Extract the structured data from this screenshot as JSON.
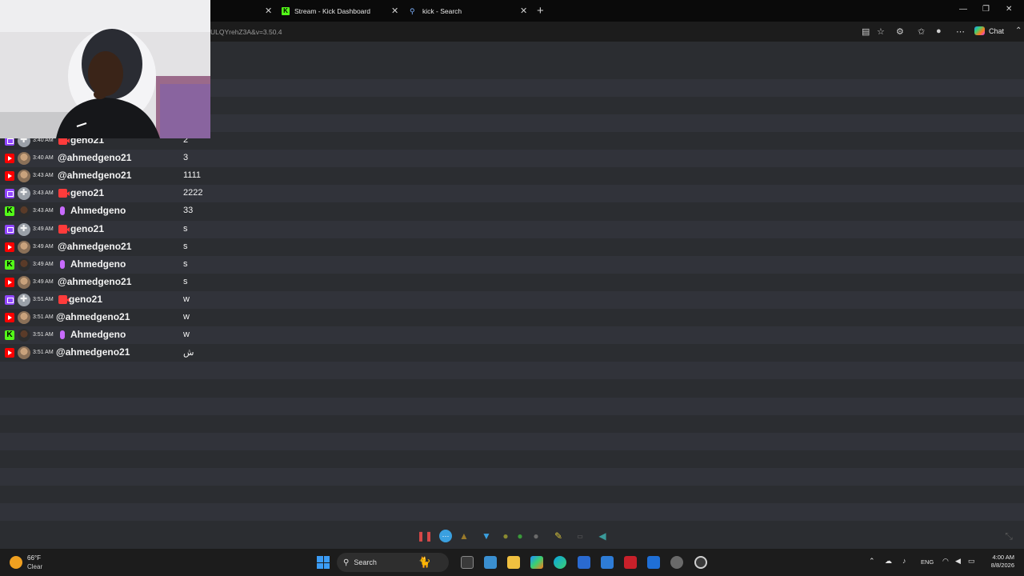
{
  "browser": {
    "tabs": [
      {
        "label": ""
      },
      {
        "label": "Stream - Kick Dashboard",
        "icon": "kick-icon"
      },
      {
        "label": "kick - Search",
        "icon": "search-icon"
      }
    ],
    "url": "ULQYrehZ3A&v=3.50.4",
    "chat_label": "Chat"
  },
  "chat": {
    "messages": [
      {
        "platform": "twitch",
        "time": "3:40 AM",
        "badge": "cam",
        "user": "geno21",
        "text": "2"
      },
      {
        "platform": "youtube",
        "time": "3:40 AM",
        "badge": "",
        "user": "@ahmedgeno21",
        "text": "3"
      },
      {
        "platform": "youtube",
        "time": "3:43 AM",
        "badge": "",
        "user": "@ahmedgeno21",
        "text": "1111"
      },
      {
        "platform": "twitch",
        "time": "3:43 AM",
        "badge": "cam",
        "user": "geno21",
        "text": "2222"
      },
      {
        "platform": "kick",
        "time": "3:43 AM",
        "badge": "mic",
        "user": "Ahmedgeno",
        "text": "33"
      },
      {
        "platform": "twitch",
        "time": "3:49 AM",
        "badge": "cam",
        "user": "geno21",
        "text": "s"
      },
      {
        "platform": "youtube",
        "time": "3:49 AM",
        "badge": "",
        "user": "@ahmedgeno21",
        "text": "s"
      },
      {
        "platform": "kick",
        "time": "3:49 AM",
        "badge": "mic",
        "user": "Ahmedgeno",
        "text": "s"
      },
      {
        "platform": "youtube",
        "time": "3:49 AM",
        "badge": "",
        "user": "@ahmedgeno21",
        "text": "s"
      },
      {
        "platform": "twitch",
        "time": "3:51 AM",
        "badge": "cam",
        "user": "geno21",
        "text": "w"
      },
      {
        "platform": "youtube",
        "time": "3:51 AM",
        "badge": "",
        "user": "@ahmedgeno21",
        "text": "w"
      },
      {
        "platform": "kick",
        "time": "3:51 AM",
        "badge": "mic",
        "user": "Ahmedgeno",
        "text": "w"
      },
      {
        "platform": "youtube",
        "time": "3:51 AM",
        "badge": "",
        "user": "@ahmedgeno21",
        "text": "ش"
      }
    ]
  },
  "taskbar": {
    "weather_temp": "66°F",
    "weather_desc": "Clear",
    "search_label": "Search",
    "lang": "ENG",
    "time": "4:00 AM",
    "date": "8/8/2026"
  },
  "colors": {
    "youtube": "#ff0000",
    "twitch": "#9146ff",
    "kick": "#53fc18",
    "background": "#2b2d31"
  }
}
